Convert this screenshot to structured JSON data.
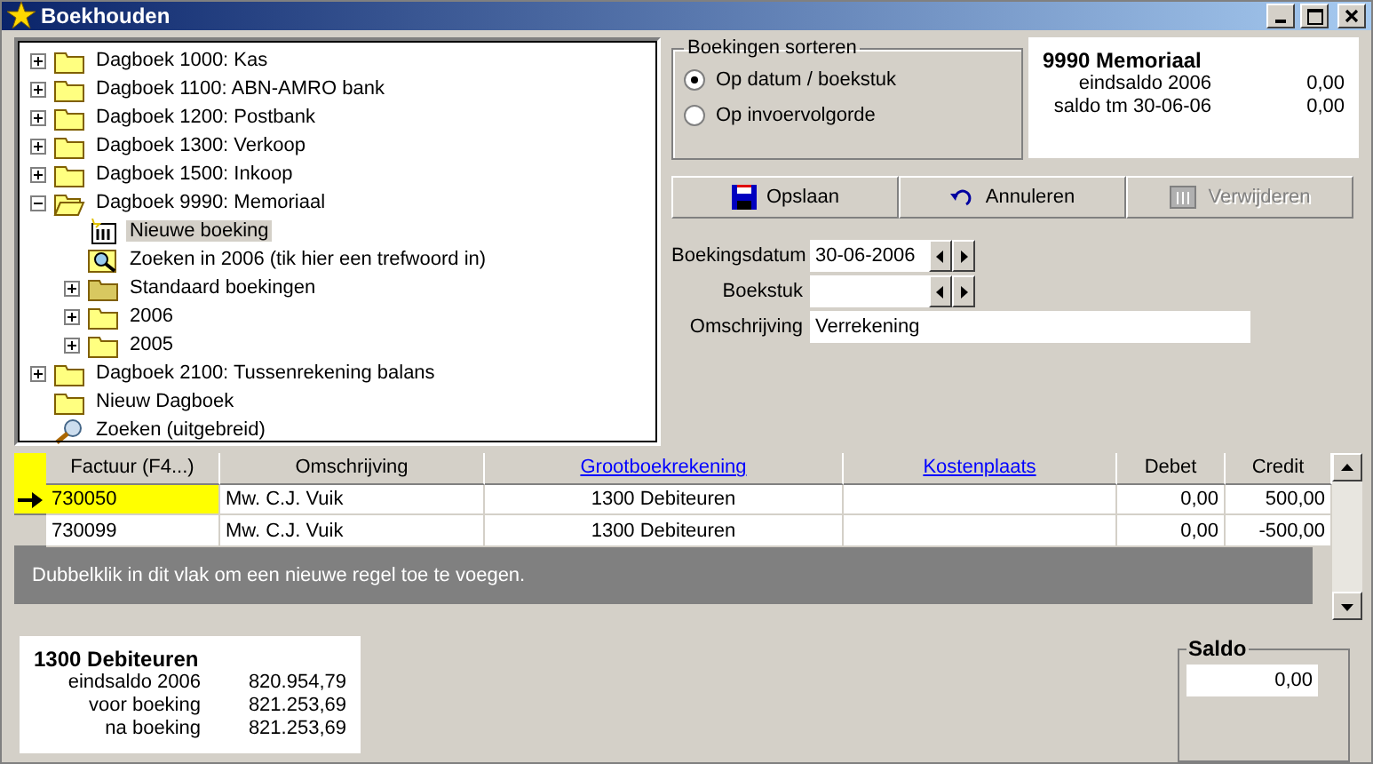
{
  "window": {
    "title": "Boekhouden"
  },
  "tree": [
    {
      "label": "Dagboek 1000: Kas",
      "kind": "folder",
      "expanded": false,
      "selected": false
    },
    {
      "label": "Dagboek 1100: ABN-AMRO bank",
      "kind": "folder",
      "expanded": false,
      "selected": false
    },
    {
      "label": "Dagboek 1200: Postbank",
      "kind": "folder",
      "expanded": false,
      "selected": false
    },
    {
      "label": "Dagboek 1300: Verkoop",
      "kind": "folder",
      "expanded": false,
      "selected": false
    },
    {
      "label": "Dagboek 1500: Inkoop",
      "kind": "folder",
      "expanded": false,
      "selected": false
    },
    {
      "label": "Dagboek 9990: Memoriaal",
      "kind": "folder",
      "expanded": true,
      "selected": false,
      "children": [
        {
          "label": "Nieuwe boeking",
          "kind": "ledger",
          "selected": true
        },
        {
          "label": "Zoeken in 2006 (tik hier een trefwoord in)",
          "kind": "search",
          "selected": false
        },
        {
          "label": "Standaard boekingen",
          "kind": "template",
          "expanded": false,
          "selected": false
        },
        {
          "label": "2006",
          "kind": "folder",
          "expanded": false,
          "selected": false
        },
        {
          "label": "2005",
          "kind": "folder",
          "expanded": false,
          "selected": false
        }
      ]
    },
    {
      "label": "Dagboek 2100: Tussenrekening balans",
      "kind": "folder",
      "expanded": false,
      "selected": false
    },
    {
      "label": "Nieuw Dagboek",
      "kind": "folder",
      "selected": false
    },
    {
      "label": "Zoeken (uitgebreid)",
      "kind": "advanced-search",
      "selected": false
    }
  ],
  "sort": {
    "title": "Boekingen sorteren",
    "options": [
      {
        "label": "Op datum / boekstuk",
        "selected": true
      },
      {
        "label": "Op invoervolgorde",
        "selected": false
      }
    ]
  },
  "journal_info": {
    "title": "9990 Memoriaal",
    "rows": [
      {
        "label": "eindsaldo 2006",
        "value": "0,00"
      },
      {
        "label": "saldo tm 30-06-06",
        "value": "0,00"
      }
    ]
  },
  "actions": [
    {
      "label": "Opslaan",
      "kind": "save",
      "disabled": false
    },
    {
      "label": "Annuleren",
      "kind": "undo",
      "disabled": false
    },
    {
      "label": "Verwijderen",
      "kind": "delete",
      "disabled": true
    }
  ],
  "form": [
    {
      "label": "Boekingsdatum",
      "value": "30-06-2006",
      "kind": "spinner"
    },
    {
      "label": "Boekstuk",
      "kind": "spinner"
    },
    {
      "label": "Omschrijving",
      "value": "Verrekening",
      "kind": "text"
    }
  ],
  "grid": {
    "columns": [
      {
        "label": "Factuur (F4...)",
        "link": false
      },
      {
        "label": "Omschrijving",
        "link": false
      },
      {
        "label": "Grootboekrekening",
        "link": true
      },
      {
        "label": "Kostenplaats",
        "link": true
      },
      {
        "label": "Debet",
        "link": false
      },
      {
        "label": "Credit",
        "link": false
      }
    ],
    "rows": [
      {
        "current": true,
        "cells": [
          "730050",
          "Mw. C.J. Vuik",
          "1300 Debiteuren",
          "",
          "0,00",
          "500,00"
        ]
      },
      {
        "current": false,
        "cells": [
          "730099",
          "Mw. C.J. Vuik",
          "1300 Debiteuren",
          "",
          "0,00",
          "-500,00"
        ]
      }
    ],
    "hint": "Dubbelklik in dit vlak om een nieuwe regel toe te voegen."
  },
  "account_info": {
    "title": "1300 Debiteuren",
    "rows": [
      {
        "label": "eindsaldo 2006",
        "value": "820.954,79"
      },
      {
        "label": "voor boeking",
        "value": "821.253,69"
      },
      {
        "label": "na boeking",
        "value": "821.253,69"
      }
    ]
  },
  "saldo": {
    "title": "Saldo",
    "value": "0,00"
  }
}
